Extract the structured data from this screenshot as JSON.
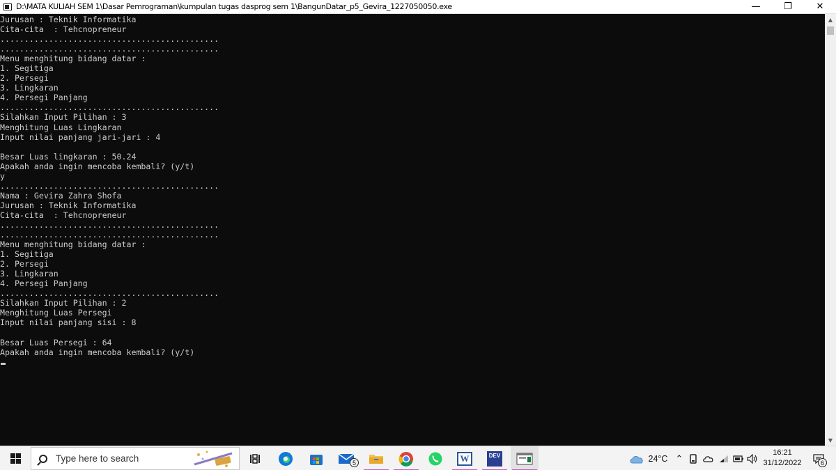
{
  "window": {
    "title": "D:\\MATA KULIAH SEM 1\\Dasar Pemrograman\\kumpulan tugas dasprog sem 1\\BangunDatar_p5_Gevira_1227050050.exe",
    "minimize_glyph": "—",
    "restore_glyph": "❐",
    "close_glyph": "✕"
  },
  "console": {
    "lines": [
      "Jurusan : Teknik Informatika",
      "Cita-cita  : Tehcnopreneur",
      ".............................................",
      ".............................................",
      "Menu menghitung bidang datar :",
      "1. Segitiga",
      "2. Persegi",
      "3. Lingkaran",
      "4. Persegi Panjang",
      ".............................................",
      "Silahkan Input Pilihan : 3",
      "Menghitung Luas Lingkaran",
      "Input nilai panjang jari-jari : 4",
      "",
      "Besar Luas lingkaran : 50.24",
      "Apakah anda ingin mencoba kembali? (y/t)",
      "y",
      ".............................................",
      "Nama : Gevira Zahra Shofa",
      "Jurusan : Teknik Informatika",
      "Cita-cita  : Tehcnopreneur",
      ".............................................",
      ".............................................",
      "Menu menghitung bidang datar :",
      "1. Segitiga",
      "2. Persegi",
      "3. Lingkaran",
      "4. Persegi Panjang",
      ".............................................",
      "Silahkan Input Pilihan : 2",
      "Menghitung Luas Persegi",
      "Input nilai panjang sisi : 8",
      "",
      "Besar Luas Persegi : 64",
      "Apakah anda ingin mencoba kembali? (y/t)"
    ]
  },
  "scrollbar": {
    "up_glyph": "▲",
    "down_glyph": "▼"
  },
  "taskbar": {
    "search_placeholder": "Type here to search",
    "mail_badge": "5",
    "word_label": "W",
    "devcpp_label": "DEV",
    "weather_temp": "24°C",
    "clock_time": "16:21",
    "clock_date": "31/12/2022",
    "notification_count": "6",
    "colors": {
      "accent_underline": "#c45bc6",
      "edge_blue": "#0f7ad8",
      "chrome_red": "#db4437",
      "whatsapp_green": "#25d366",
      "word_blue": "#2b579a"
    }
  }
}
